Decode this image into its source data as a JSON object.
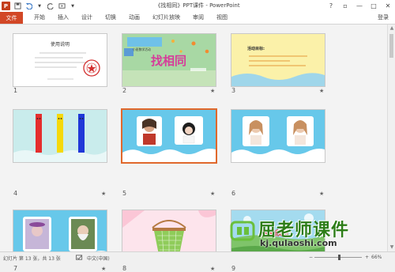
{
  "window": {
    "title": "《找相同》PPT课件 - PowerPoint",
    "controls": {
      "help": "?",
      "restore": "▫",
      "minimize": "—",
      "maximize": "□",
      "close": "✕"
    }
  },
  "ribbon": {
    "file_tab": "文件",
    "tabs": [
      "开始",
      "插入",
      "设计",
      "切换",
      "动画",
      "幻灯片放映",
      "审阅",
      "视图"
    ],
    "login": "登录"
  },
  "slides": [
    {
      "num": "1",
      "title": "使用说明",
      "star": false
    },
    {
      "num": "2",
      "title": "找相同",
      "subtitle": "小班数学活动",
      "star": true
    },
    {
      "num": "3",
      "title": "活动目标:",
      "star": true
    },
    {
      "num": "4",
      "star": true
    },
    {
      "num": "5",
      "star": true
    },
    {
      "num": "6",
      "star": true
    },
    {
      "num": "7",
      "star": true
    },
    {
      "num": "8",
      "star": true
    },
    {
      "num": "9",
      "title": "谢谢欣赏",
      "star": false
    }
  ],
  "status": {
    "slide_info": "幻灯片 第 13 张，共 13 张",
    "language": "中文(中国)",
    "zoom": "66%"
  },
  "watermark": {
    "name": "屈老师课件",
    "url": "kj.qulaoshi.com"
  },
  "colors": {
    "accent": "#d24726",
    "selected_border": "#e0682c",
    "wm_green": "#2d7d18"
  }
}
